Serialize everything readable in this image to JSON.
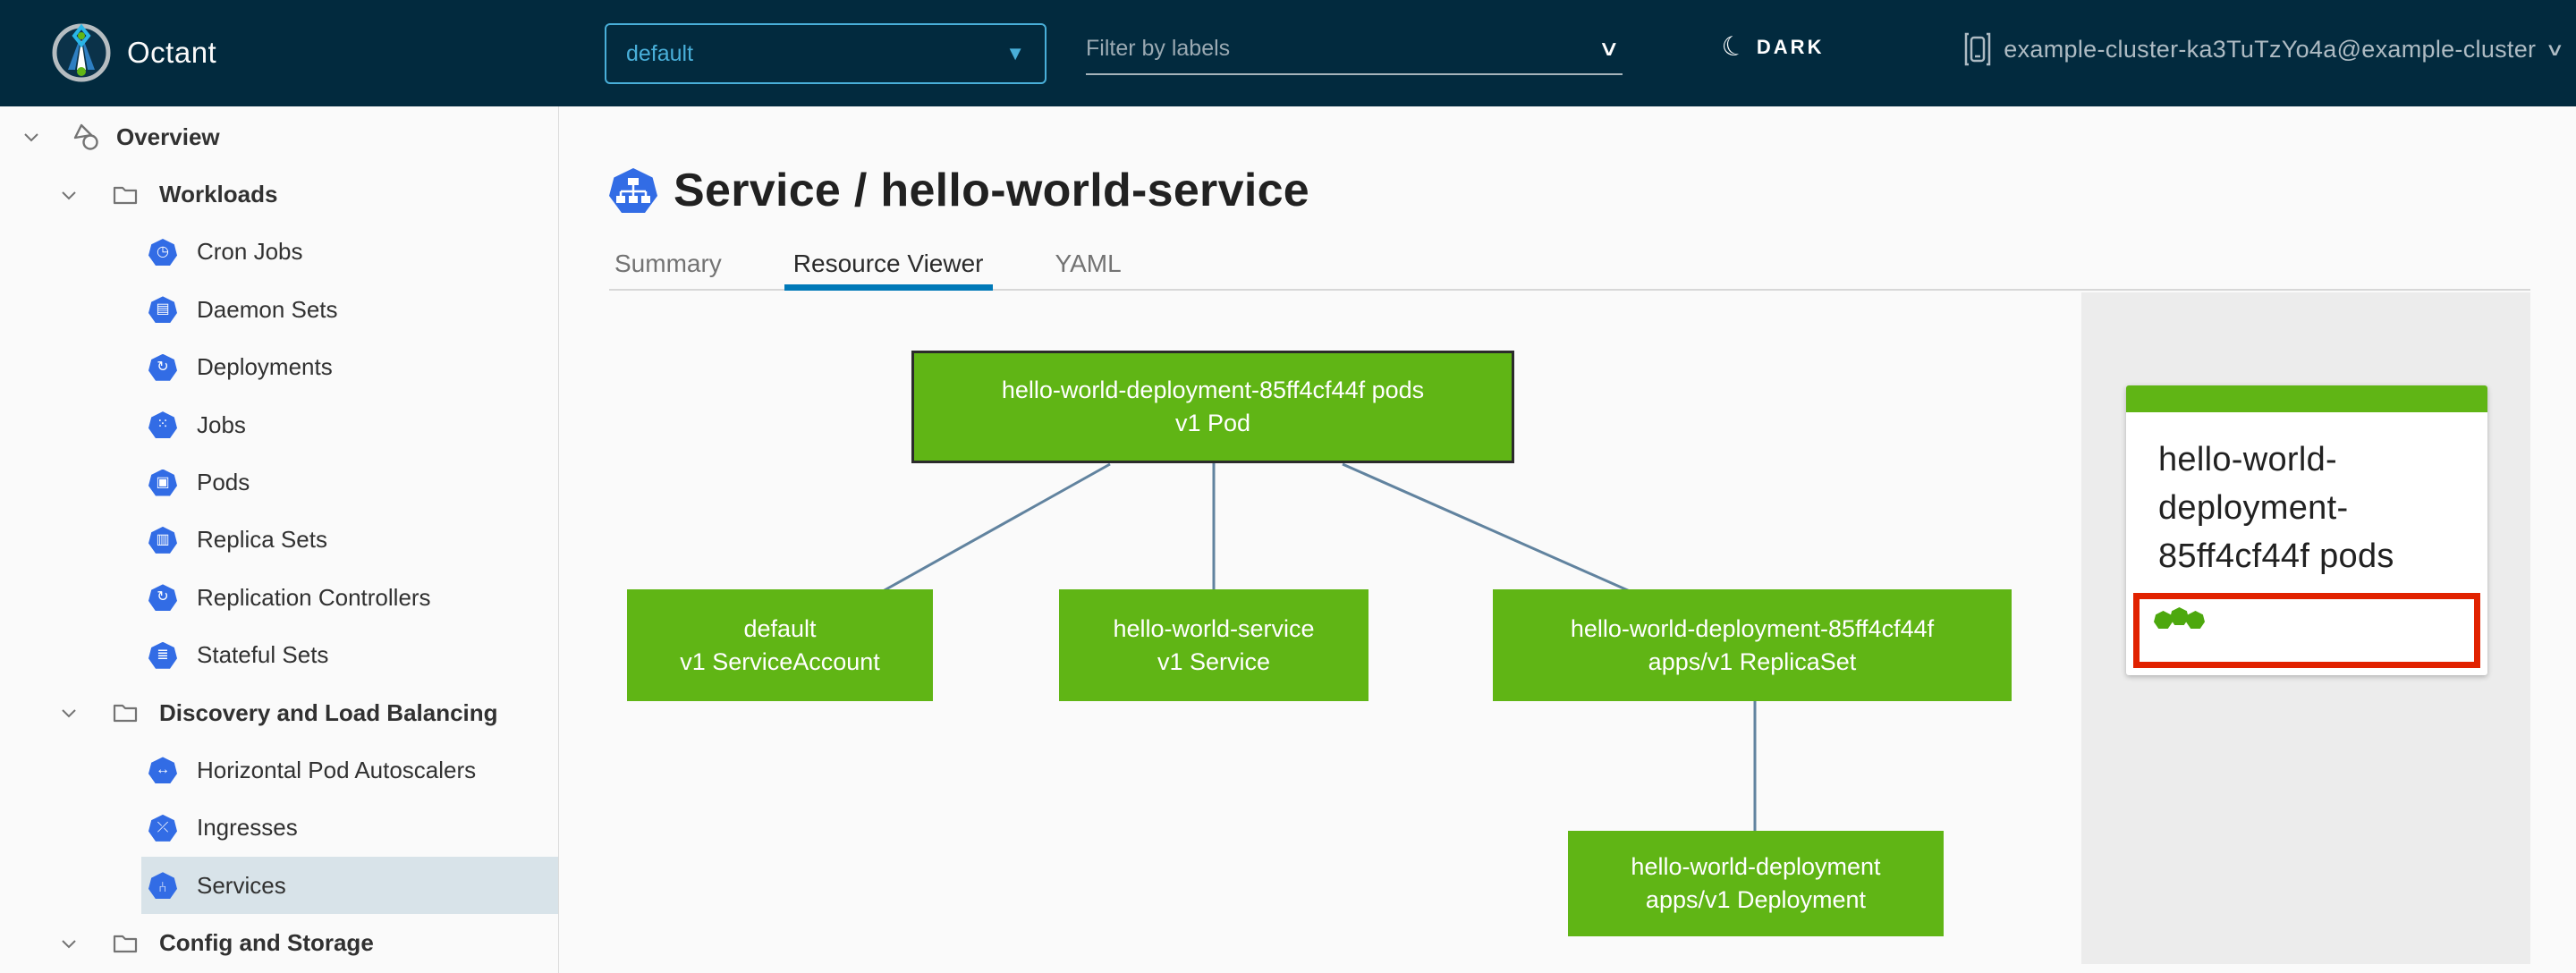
{
  "header": {
    "app_title": "Octant",
    "namespace": "default",
    "filter_placeholder": "Filter by labels",
    "theme_label": "DARK",
    "cluster_label": "example-cluster-ka3TuTzYo4a@example-cluster"
  },
  "sidebar": {
    "items": [
      {
        "label": "Overview",
        "level": 0
      },
      {
        "label": "Workloads",
        "level": 1
      },
      {
        "label": "Cron Jobs",
        "level": 2,
        "glyph": "◷"
      },
      {
        "label": "Daemon Sets",
        "level": 2,
        "glyph": "▤"
      },
      {
        "label": "Deployments",
        "level": 2,
        "glyph": "↻"
      },
      {
        "label": "Jobs",
        "level": 2,
        "glyph": "⁙"
      },
      {
        "label": "Pods",
        "level": 2,
        "glyph": "▣"
      },
      {
        "label": "Replica Sets",
        "level": 2,
        "glyph": "▥"
      },
      {
        "label": "Replication Controllers",
        "level": 2,
        "glyph": "↻"
      },
      {
        "label": "Stateful Sets",
        "level": 2,
        "glyph": "≣"
      },
      {
        "label": "Discovery and Load Balancing",
        "level": 1
      },
      {
        "label": "Horizontal Pod Autoscalers",
        "level": 2,
        "glyph": "↔"
      },
      {
        "label": "Ingresses",
        "level": 2,
        "glyph": "⤫"
      },
      {
        "label": "Services",
        "level": 2,
        "glyph": "⑂",
        "selected": true
      },
      {
        "label": "Config and Storage",
        "level": 1
      }
    ]
  },
  "main": {
    "title": "Service / hello-world-service",
    "tabs": [
      {
        "label": "Summary",
        "active": false
      },
      {
        "label": "Resource Viewer",
        "active": true
      },
      {
        "label": "YAML",
        "active": false
      }
    ]
  },
  "graph": {
    "nodes": [
      {
        "name": "hello-world-deployment-85ff4cf44f pods",
        "kind": "v1 Pod",
        "selected": true
      },
      {
        "name": "default",
        "kind": "v1 ServiceAccount",
        "selected": false
      },
      {
        "name": "hello-world-service",
        "kind": "v1 Service",
        "selected": false
      },
      {
        "name": "hello-world-deployment-85ff4cf44f",
        "kind": "apps/v1 ReplicaSet",
        "selected": false
      },
      {
        "name": "hello-world-deployment",
        "kind": "apps/v1 Deployment",
        "selected": false
      }
    ],
    "edges": [
      {
        "from": "hello-world-deployment-85ff4cf44f pods",
        "to": "default"
      },
      {
        "from": "hello-world-deployment-85ff4cf44f pods",
        "to": "hello-world-service"
      },
      {
        "from": "hello-world-deployment-85ff4cf44f pods",
        "to": "hello-world-deployment-85ff4cf44f"
      },
      {
        "from": "hello-world-deployment-85ff4cf44f",
        "to": "hello-world-deployment"
      }
    ]
  },
  "panel": {
    "card_title": "hello-world-deployment-85ff4cf44f pods",
    "pod_status_count": 3
  },
  "colors": {
    "header_bg": "#022a3e",
    "accent_blue": "#49afd9",
    "k8s_blue": "#326ce5",
    "node_green": "#60b515",
    "selected_row": "#d8e3e9",
    "tab_underline": "#0079b8",
    "edge_line": "#61839f",
    "alert_red": "#e12200",
    "panel_bg": "#ececec"
  }
}
